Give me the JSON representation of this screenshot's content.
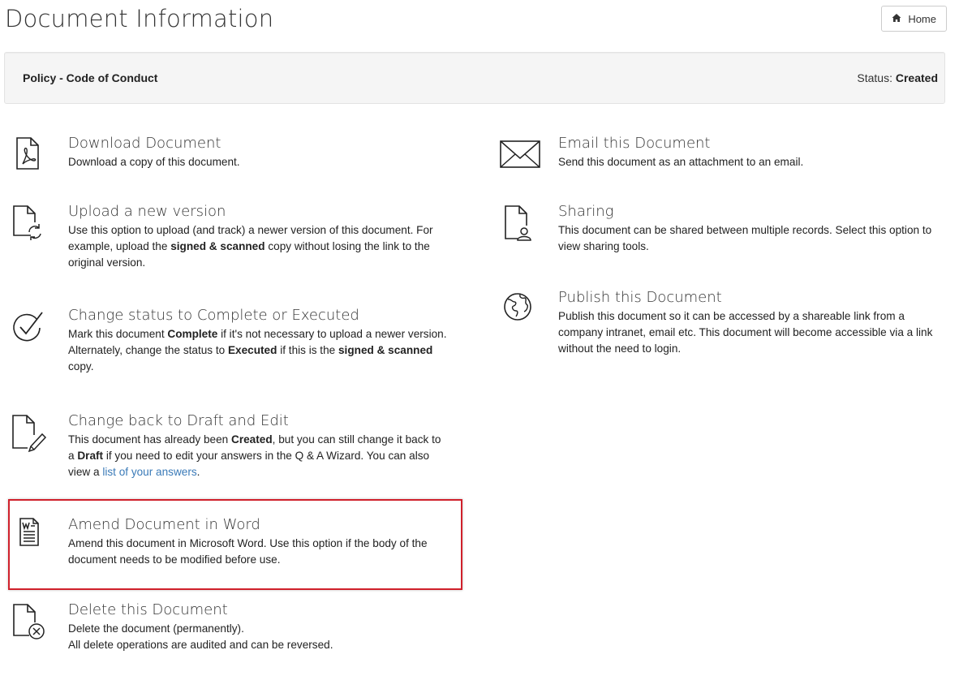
{
  "header": {
    "title": "Document Information",
    "home_label": "Home",
    "home_icon": "home-icon"
  },
  "document": {
    "name": "Policy - Code of Conduct",
    "status_label": "Status:",
    "status_value": "Created"
  },
  "actions_left": [
    {
      "title": "Download Document",
      "icon": "pdf-file-icon",
      "desc": [
        "Download a copy of this document."
      ]
    },
    {
      "title": "Upload a new version",
      "icon": "file-upload-icon",
      "desc": [
        "Use this option to upload (and track) a newer version of this document. For example, upload the ",
        "signed & scanned",
        " copy without losing the link to the original version."
      ]
    },
    {
      "title": "Change status to Complete or Executed",
      "icon": "checkmark-circle-icon",
      "desc": [
        "Mark this document ",
        "Complete",
        " if it's not necessary to upload a newer version. Alternately, change the status to ",
        "Executed",
        " if this is the ",
        "signed & scanned",
        " copy."
      ]
    },
    {
      "title": "Change back to Draft and Edit",
      "icon": "file-edit-icon",
      "desc": [
        "This document has already been ",
        "Created",
        ", but you can still change it back to a ",
        "Draft",
        " if you need to edit your answers in the Q & A Wizard. You can also view a ",
        "list of your answers",
        "."
      ]
    },
    {
      "title": "Amend Document in Word",
      "icon": "word-document-icon",
      "desc": [
        "Amend this document in Microsoft Word. Use this option if the body of the document needs to be modified before use."
      ]
    },
    {
      "title": "Delete this Document",
      "icon": "file-delete-icon",
      "desc": [
        "Delete the document (permanently).",
        "All delete operations are audited and can be reversed."
      ]
    }
  ],
  "actions_right": [
    {
      "title": "Email this Document",
      "icon": "envelope-icon",
      "desc": [
        "Send this document as an attachment to an email."
      ]
    },
    {
      "title": "Sharing",
      "icon": "file-user-icon",
      "desc": [
        "This document can be shared between multiple records. Select this option to view sharing tools."
      ]
    },
    {
      "title": "Publish this Document",
      "icon": "globe-icon",
      "desc": [
        "Publish this document so it can be accessed by a shareable link from a company intranet, email etc. This document will become accessible via a link without the need to login."
      ]
    }
  ],
  "highlight_color": "#d0202b",
  "link_color": "#3a7ab8"
}
